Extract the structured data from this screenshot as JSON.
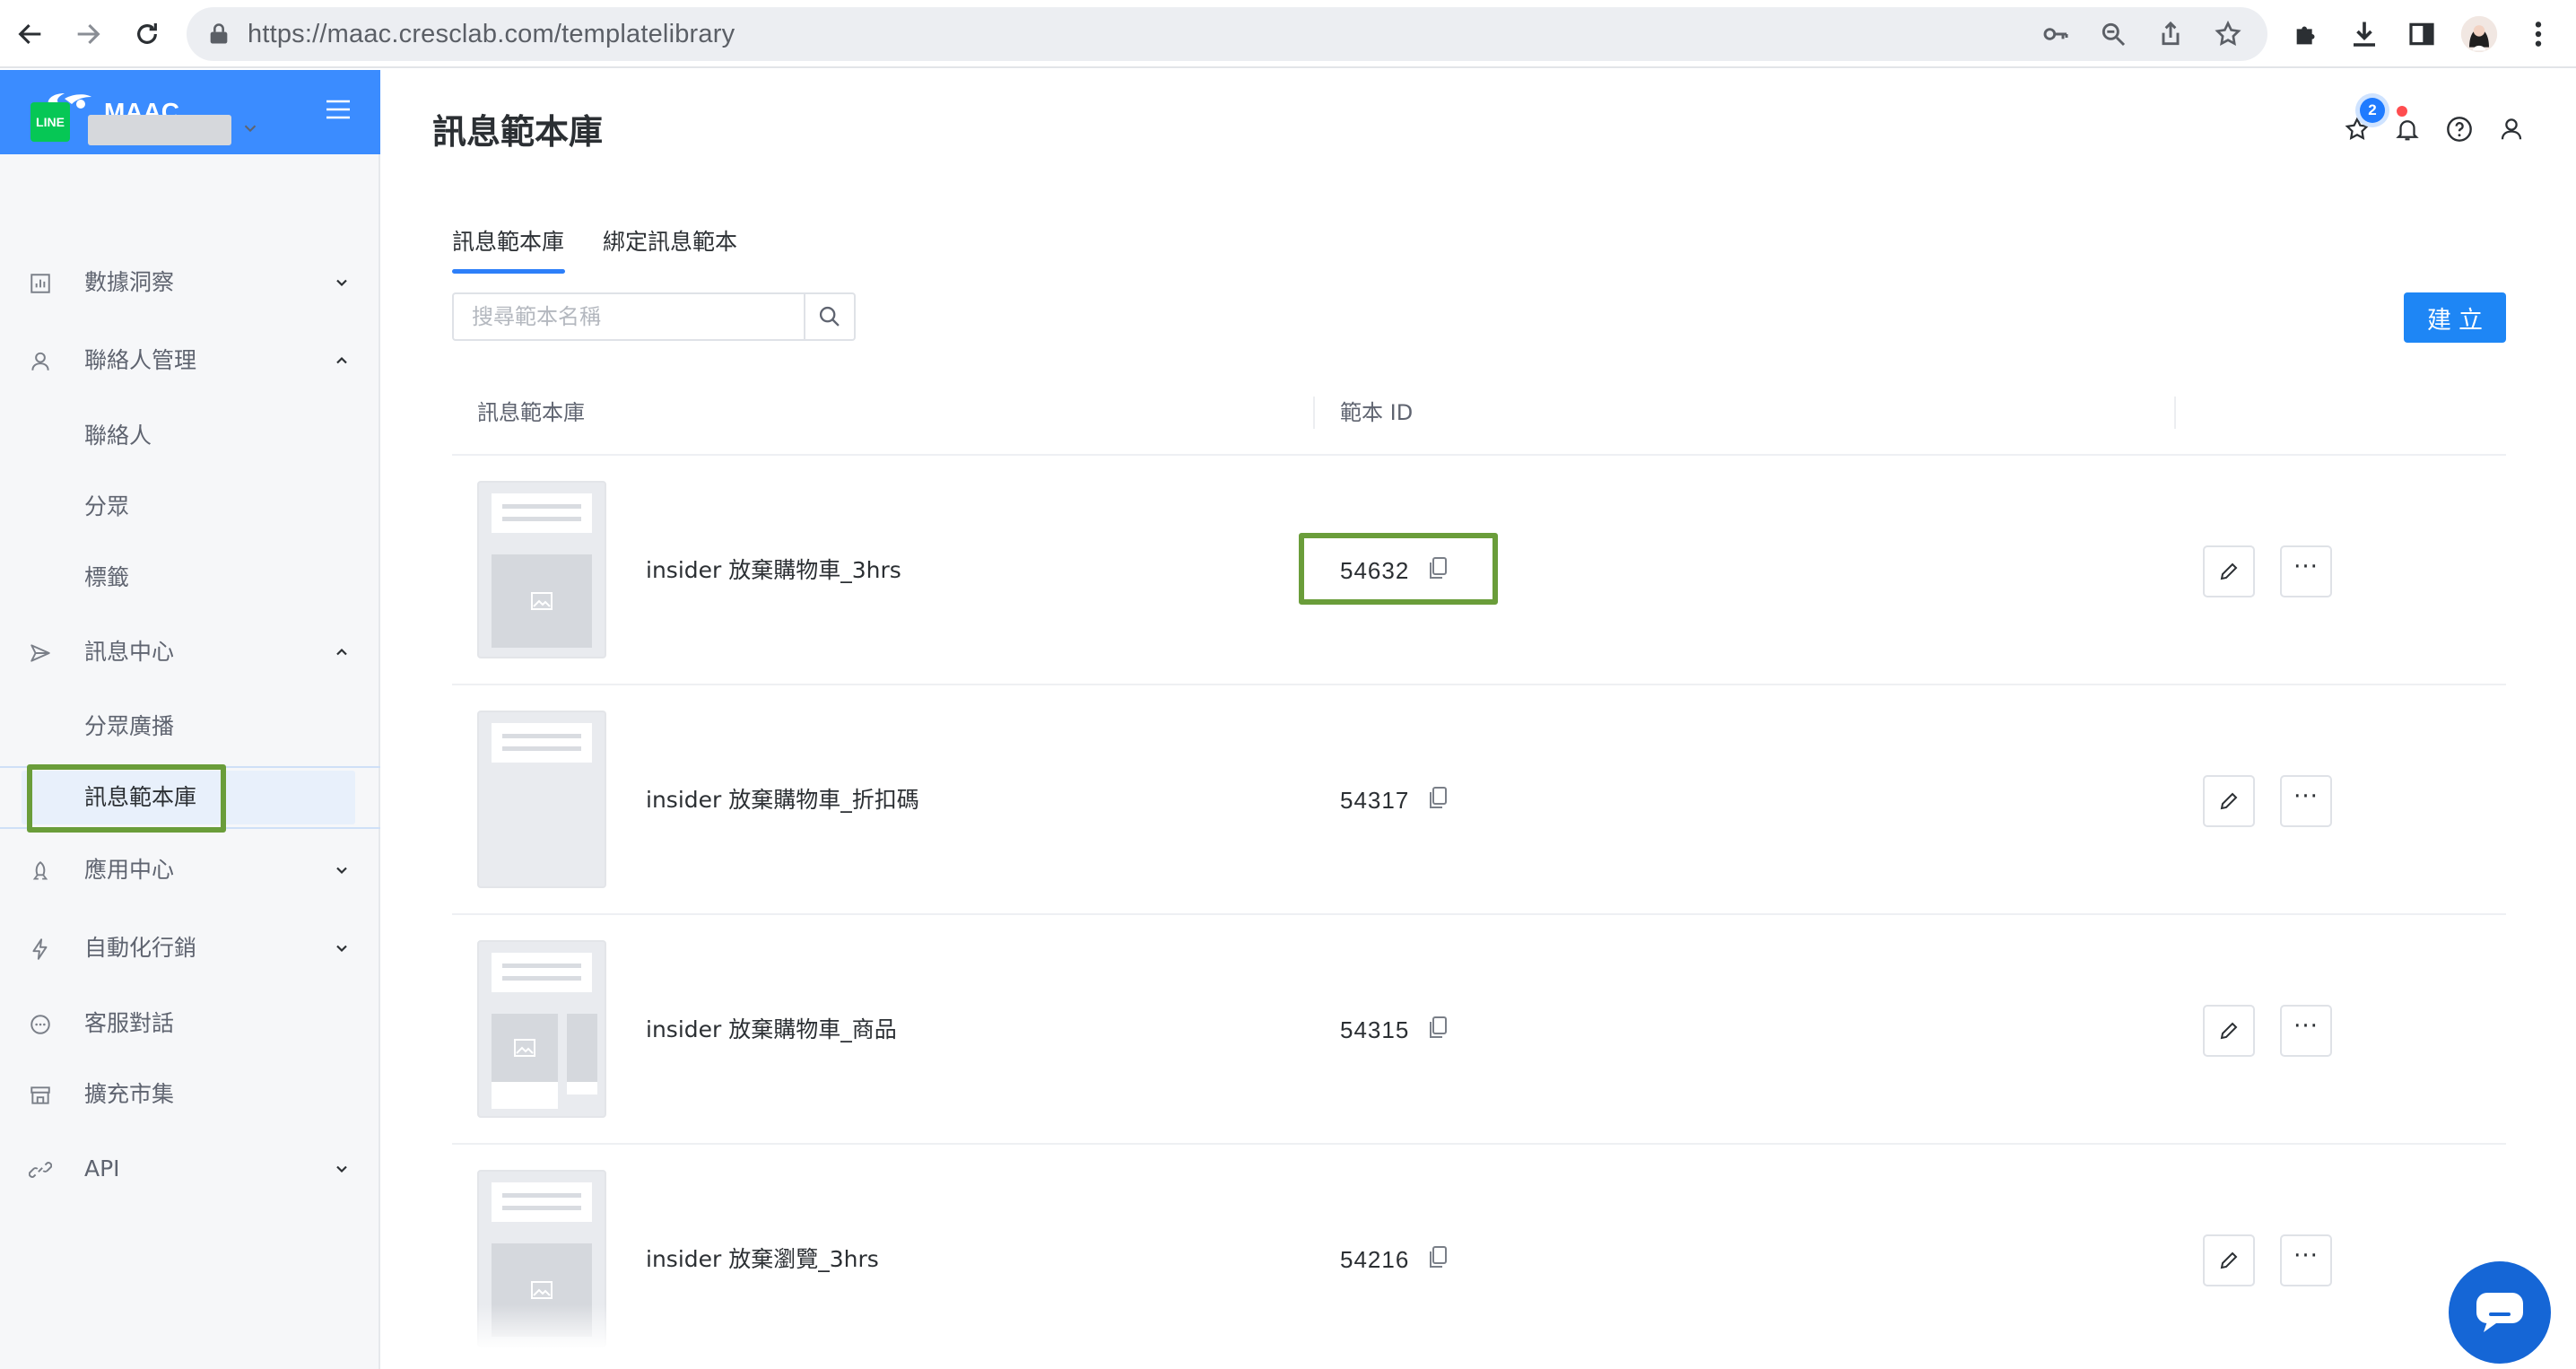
{
  "browser": {
    "url": "https://maac.cresclab.com/templatelibrary",
    "icons": [
      "back-arrow-icon",
      "forward-arrow-icon",
      "reload-icon",
      "lock-icon",
      "key-icon",
      "zoom-icon",
      "share-icon",
      "star-icon",
      "puzzle-icon",
      "download-icon",
      "sidepanel-icon",
      "profile-avatar",
      "kebab-menu-icon"
    ]
  },
  "brand": {
    "name": "MAAC"
  },
  "channel": {
    "badge": "LINE"
  },
  "sidebar": {
    "items": [
      {
        "label": "數據洞察",
        "icon": "bar-chart-icon",
        "expanded": false
      },
      {
        "label": "聯絡人管理",
        "icon": "person-icon",
        "expanded": true,
        "children": [
          "聯絡人",
          "分眾",
          "標籤"
        ]
      },
      {
        "label": "訊息中心",
        "icon": "send-icon",
        "expanded": true,
        "children": [
          "分眾廣播",
          "訊息範本庫"
        ]
      },
      {
        "label": "應用中心",
        "icon": "rocket-icon",
        "expanded": false
      },
      {
        "label": "自動化行銷",
        "icon": "lightning-icon",
        "expanded": false
      },
      {
        "label": "客服對話",
        "icon": "chat-bubble-icon"
      },
      {
        "label": "擴充市集",
        "icon": "store-icon"
      },
      {
        "label": "API",
        "icon": "link-icon",
        "expanded": false
      }
    ],
    "active_item": "訊息範本庫"
  },
  "header": {
    "title": "訊息範本庫",
    "notification_count": "2"
  },
  "tabs": [
    {
      "label": "訊息範本庫",
      "active": true
    },
    {
      "label": "綁定訊息範本",
      "active": false
    }
  ],
  "search": {
    "placeholder": "搜尋範本名稱"
  },
  "create_button": "建立",
  "table": {
    "columns": [
      "訊息範本庫",
      "範本 ID"
    ],
    "rows": [
      {
        "name": "insider 放棄購物車_3hrs",
        "id": "54632",
        "thumb": "header-image"
      },
      {
        "name": "insider 放棄購物車_折扣碼",
        "id": "54317",
        "thumb": "header-only"
      },
      {
        "name": "insider 放棄購物車_商品",
        "id": "54315",
        "thumb": "header-carousel"
      },
      {
        "name": "insider 放棄瀏覽_3hrs",
        "id": "54216",
        "thumb": "header-image"
      }
    ],
    "more_label": "···"
  },
  "colors": {
    "brand": "#3b8cff",
    "primary_button": "#1e86f5",
    "highlight_frame": "#6a9d3a",
    "line_green": "#06c755",
    "chat_widget": "#1566d6"
  }
}
